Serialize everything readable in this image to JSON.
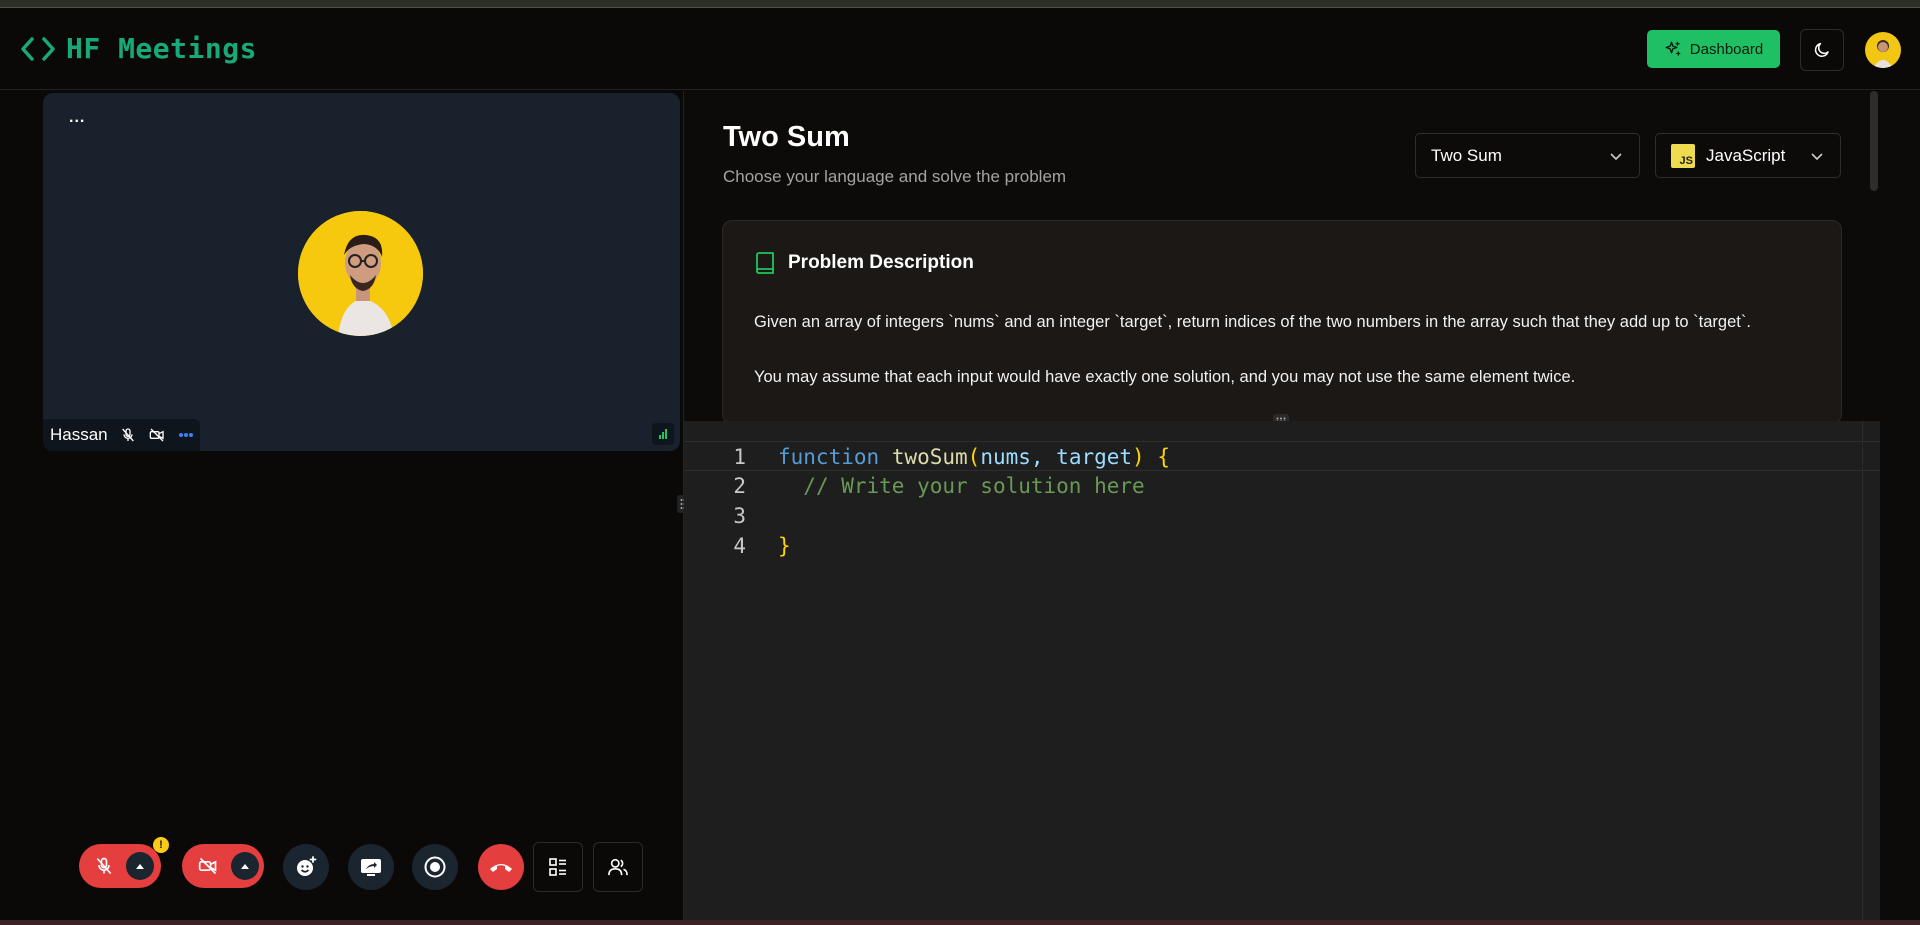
{
  "header": {
    "app_name": "HF Meetings",
    "dashboard_label": "Dashboard",
    "accent_color": "#18a97b",
    "dashboard_color": "#1fc064"
  },
  "meeting": {
    "tile_menu": "...",
    "participant_name": "Hassan",
    "warning_badge": "!",
    "controls": [
      "mic-off",
      "camera-off",
      "reactions",
      "share-screen",
      "record",
      "leave-call",
      "layout",
      "participants"
    ]
  },
  "problem": {
    "title": "Two Sum",
    "subtitle": "Choose your language and solve the problem",
    "problem_select": "Two Sum",
    "language_select": "JavaScript",
    "js_badge": "JS",
    "description_heading": "Problem Description",
    "description_1": "Given an array of integers `nums` and an integer `target`, return indices of the two numbers in the array such that they add up to `target`.",
    "description_2": "You may assume that each input would have exactly one solution, and you may not use the same element twice."
  },
  "editor": {
    "lines": [
      {
        "num": "1",
        "keyword": "function",
        "name": "twoSum",
        "params": "nums, target"
      },
      {
        "num": "2",
        "comment": "// Write your solution here"
      },
      {
        "num": "3"
      },
      {
        "num": "4",
        "text": "}"
      }
    ]
  }
}
